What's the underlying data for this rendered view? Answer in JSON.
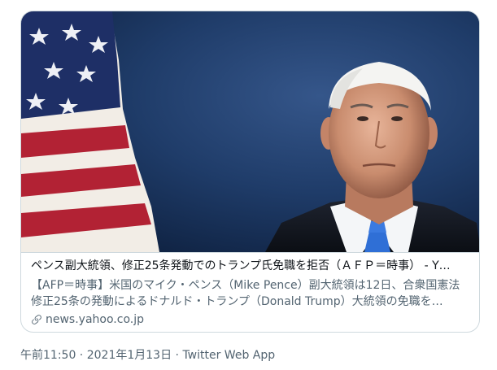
{
  "card": {
    "image": {
      "icon": "news-photo",
      "accent_colors": {
        "background": "#1b3560",
        "flag_red": "#b22234",
        "tie_blue": "#2f6fd6"
      }
    },
    "title": "ペンス副大統領、修正25条発動でのトランプ氏免職を拒否（ＡＦＰ＝時事） - Y…",
    "description": "【AFP＝時事】米国のマイク・ペンス（Mike Pence）副大統領は12日、合衆国憲法修正25条の発動によるドナルド・トランプ（Donald Trump）大統領の免職を…",
    "domain": "news.yahoo.co.jp",
    "domain_icon": "link-icon"
  },
  "meta": {
    "time": "午前11:50",
    "separator1": " · ",
    "date": "2021年1月13日",
    "separator2": " · ",
    "source": "Twitter Web App"
  }
}
